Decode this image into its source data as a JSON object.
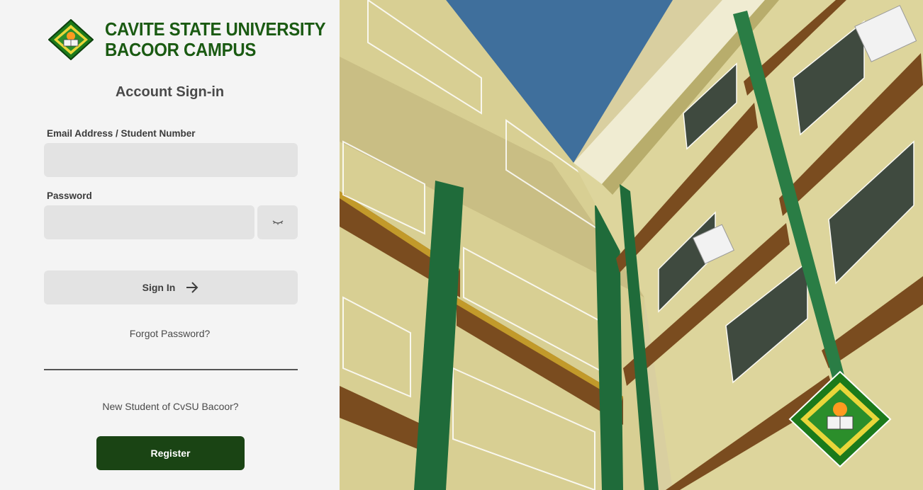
{
  "brand": {
    "line1": "CAVITE STATE UNIVERSITY",
    "line2": "BACOOR CAMPUS"
  },
  "form": {
    "heading": "Account Sign-in",
    "email_label": "Email Address / Student Number",
    "email_value": "",
    "password_label": "Password",
    "password_value": "",
    "signin_label": "Sign In",
    "forgot_label": "Forgot Password?",
    "new_student_text": "New Student of CvSU Bacoor?",
    "register_label": "Register"
  },
  "colors": {
    "brand_green": "#1a5a12",
    "register_bg": "#1a4414",
    "field_bg": "#e3e3e3",
    "page_bg": "#f4f4f4"
  },
  "icons": {
    "logo": "cvsu-seal-icon",
    "password_toggle": "eye-closed-icon",
    "signin_arrow": "arrow-right-icon",
    "photo_seal": "cvsu-seal-icon"
  }
}
